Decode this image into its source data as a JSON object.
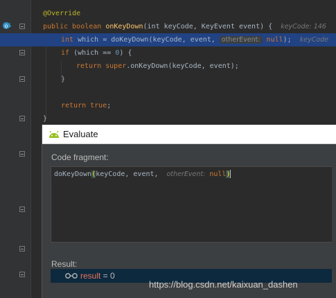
{
  "editor": {
    "lines": [
      {
        "parts": [
          [
            "ann",
            "@Override"
          ]
        ]
      },
      {
        "parts": [
          [
            "kw",
            "public "
          ],
          [
            "kw",
            "boolean "
          ],
          [
            "fn",
            "onKeyDown"
          ],
          [
            "id",
            "(int keyCode, KeyEvent event) {  "
          ],
          [
            "hint",
            "keyCode: 146"
          ]
        ]
      },
      {
        "parts": [
          [
            "kw",
            "int "
          ],
          [
            "id",
            "which = doKeyDown(keyCode, event, "
          ],
          [
            "hintbox",
            "otherEvent:"
          ],
          [
            "kw",
            " null"
          ],
          [
            "id",
            ");  "
          ],
          [
            "hint",
            "keyCode"
          ]
        ]
      },
      {
        "parts": [
          [
            "kw",
            "if "
          ],
          [
            "id",
            "(which == "
          ],
          [
            "num",
            "0"
          ],
          [
            "id",
            ") {"
          ]
        ]
      },
      {
        "parts": [
          [
            "kw",
            "return super"
          ],
          [
            "id",
            ".onKeyDown(keyCode, event);"
          ]
        ]
      },
      {
        "parts": [
          [
            "id",
            "}"
          ]
        ]
      },
      {
        "parts": []
      },
      {
        "parts": [
          [
            "kw",
            "return true"
          ],
          [
            "id",
            ";"
          ]
        ]
      },
      {
        "parts": [
          [
            "id",
            "}"
          ]
        ]
      }
    ]
  },
  "dialog": {
    "title": "Evaluate",
    "code_fragment_label": "Code fragment:",
    "fragment": {
      "before": "doKeyDown",
      "open_paren": "(",
      "args": "keyCode, event, ",
      "hint": "otherEvent:",
      "null_kw": "null",
      "close_paren": ")"
    },
    "result_label": "Result:",
    "result_name": "result",
    "result_eq": " = ",
    "result_value": "0"
  },
  "watermark": "https://blog.csdn.net/kaixuan_dashen",
  "colors": {
    "background": "#2b2b2b",
    "selection": "#214283",
    "keyword": "#cc7832",
    "result_row": "#0d293e"
  }
}
